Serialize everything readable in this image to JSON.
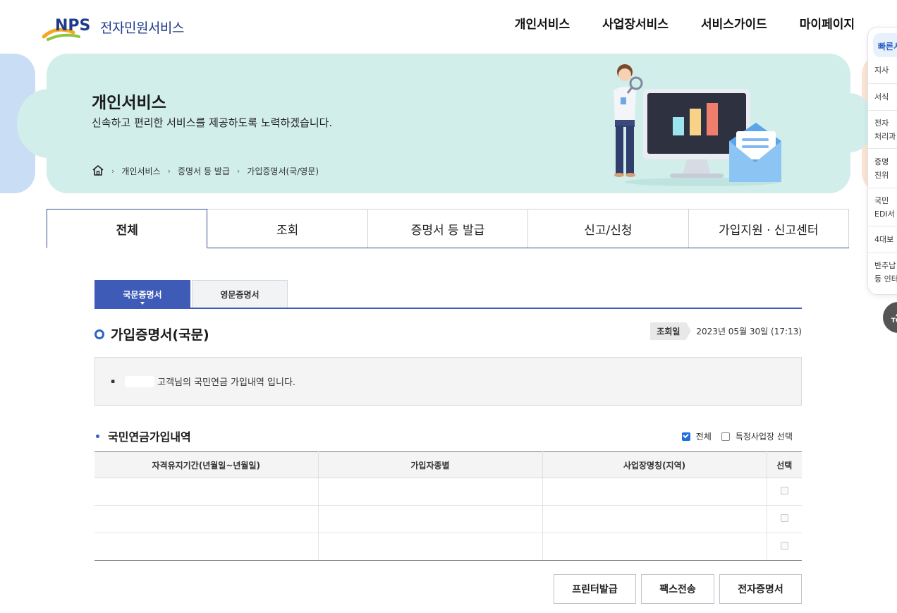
{
  "header": {
    "logo_mark": "NPS",
    "logo_text": "전자민원서비스",
    "nav": [
      "개인서비스",
      "사업장서비스",
      "서비스가이드",
      "마이페이지"
    ]
  },
  "hero": {
    "title": "개인서비스",
    "subtitle": "신속하고 편리한 서비스를 제공하도록 노력하겠습니다.",
    "breadcrumb": [
      "개인서비스",
      "증명서 등 발급",
      "가입증명서(국/영문)"
    ]
  },
  "main_tabs": [
    "전체",
    "조회",
    "증명서 등 발급",
    "신고/신청",
    "가입지원 · 신고센터"
  ],
  "sub_tabs": [
    "국문증명서",
    "영문증명서"
  ],
  "section": {
    "title": "가입증명서(국문)",
    "inquiry_label": "조회일",
    "inquiry_date": "2023년 05월 30일 (17:13)"
  },
  "notice": {
    "bullet": "▪",
    "text": "고객님의 국민연금 가입내역 입니다."
  },
  "subsection": {
    "title": "국민연금가입내역",
    "filter_all": "전체",
    "filter_specific": "특정사업장 선택"
  },
  "table": {
    "headers": [
      "자격유지기간(년월일~년월일)",
      "가입자종별",
      "사업장명칭(지역)",
      "선택"
    ],
    "rows": [
      {
        "period": "",
        "type": "",
        "workplace": ""
      },
      {
        "period": "",
        "type": "",
        "workplace": ""
      },
      {
        "period": "",
        "type": "",
        "workplace": ""
      }
    ]
  },
  "buttons": {
    "print": "프린터발급",
    "fax": "팩스전송",
    "electronic": "전자증명서"
  },
  "quick_menu": {
    "title": "빠른서",
    "items": [
      [
        "지사"
      ],
      [
        "서식"
      ],
      [
        "전자",
        "처리과"
      ],
      [
        "증명",
        "진위"
      ],
      [
        "국민",
        "EDI서"
      ],
      [
        "4대보"
      ],
      [
        "반추납",
        "등 인터"
      ]
    ],
    "top_label": "TOP"
  },
  "colors": {
    "primary": "#3e5bb8",
    "hero_bg": "#d1eeeb",
    "accent_blue": "#2f63c6"
  }
}
